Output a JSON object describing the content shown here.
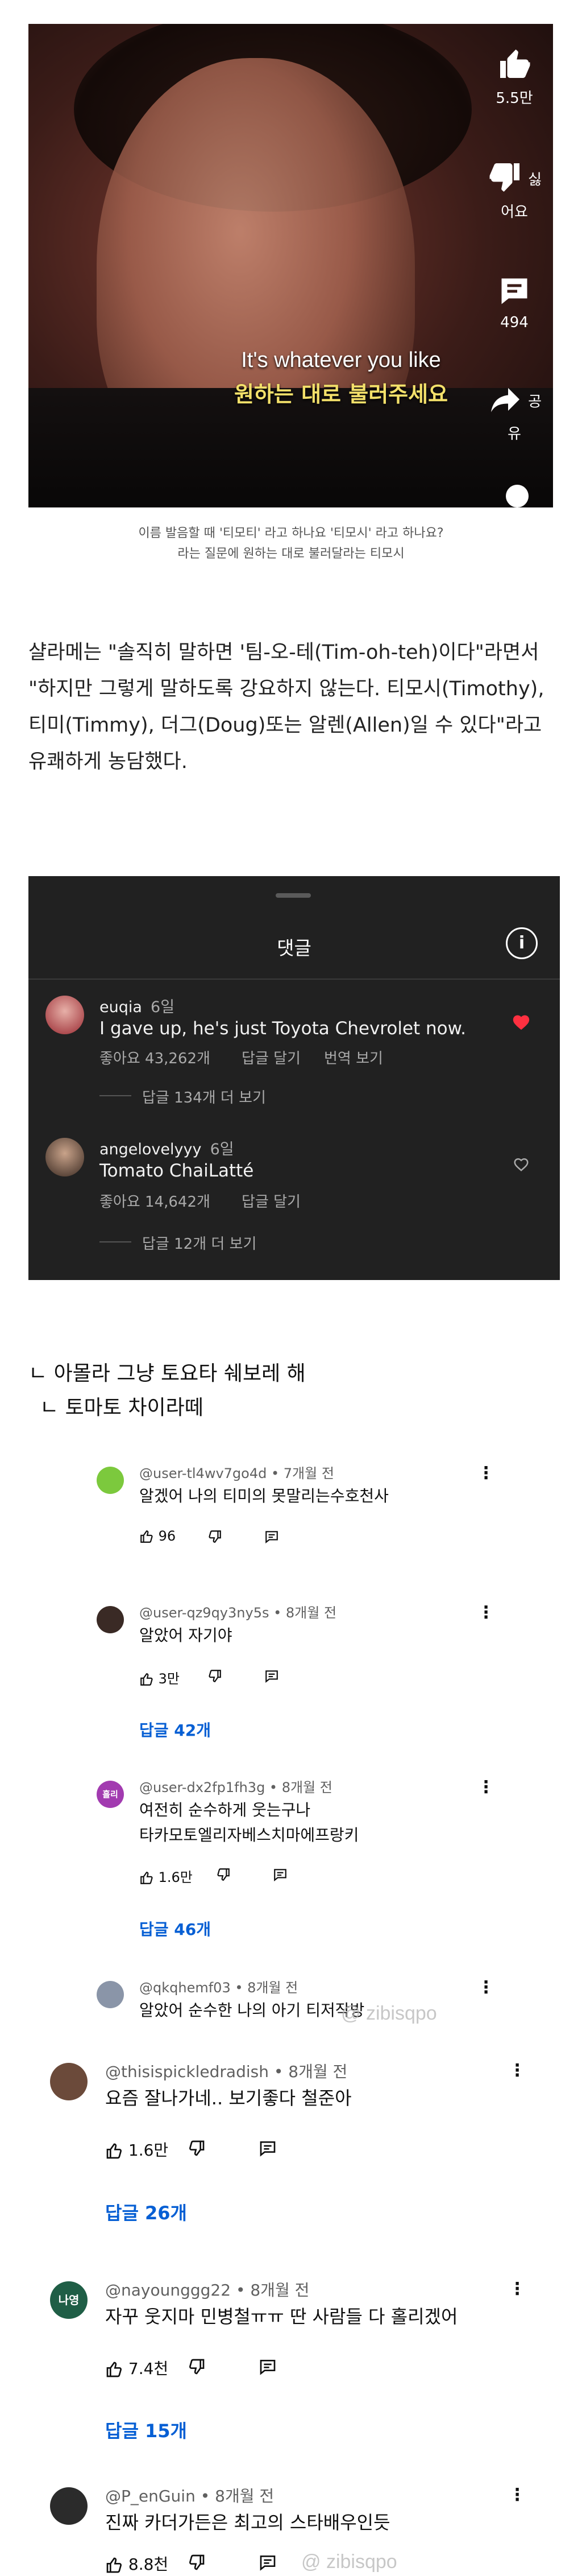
{
  "video": {
    "subtitle_en": "It's whatever you like",
    "subtitle_ko": "원하는 대로 불러주세요",
    "like_count": "5.5만",
    "dislike_label": "싫어요",
    "comment_count": "494",
    "share_label": "공유",
    "caption_line1": "이름 발음할 때 '티모티' 라고 하나요 '티모시' 라고 하나요?",
    "caption_line2": "라는 질문에 원하는 대로 불러달라는 티모시"
  },
  "article": {
    "paragraph": "샬라메는 \"솔직히 말하면 '팀-오-테(Tim-oh-teh)이다\"라면서 \"하지만 그렇게 말하도록 강요하지 않는다. 티모시(Timothy), 티미(Timmy), 더그(Doug)또는 알렌(Allen)일 수 있다\"라고 유쾌하게 농담했다."
  },
  "dark_panel": {
    "title": "댓글",
    "comments": [
      {
        "user": "euqia",
        "age": "6일",
        "text": "I gave up, he's just Toyota Chevrolet now.",
        "likes": "좋아요 43,262개",
        "reply": "답글 달기",
        "translate": "번역 보기",
        "view_replies": "답글 134개 더 보기"
      },
      {
        "user": "angelovelyyy",
        "age": "6일",
        "text": "Tomato ChaiLatté",
        "likes": "좋아요 14,642개",
        "reply": "답글 달기",
        "view_replies": "답글 12개 더 보기"
      }
    ]
  },
  "threads": {
    "line1": "ㄴ 아몰라 그냥 토요타 쉐보레 해",
    "line2": "ㄴ 토마토 차이라떼"
  },
  "comments_small": [
    {
      "user": "@user-tl4wv7go4d • 7개월 전",
      "text": "알겠어 나의 티미의 못말리는수호천사",
      "likes": "96",
      "avatar_color": "#7cc93d",
      "avatar_text": ""
    },
    {
      "user": "@user-qz9qy3ny5s • 8개월 전",
      "text": "알았어 자기야",
      "likes": "3만",
      "replies": "답글 42개",
      "avatar_color": "#3a2a25",
      "avatar_text": ""
    },
    {
      "user": "@user-dx2fp1fh3g • 8개월 전",
      "text": "여전히 순수하게 웃는구나",
      "text2": "타카모토엘리자베스치마에프랑키",
      "likes": "1.6만",
      "replies": "답글 46개",
      "avatar_color": "#a23bb0",
      "avatar_text": "흘리"
    },
    {
      "user": "@qkqhemf03 • 8개월 전",
      "text": "알았어 순수한 나의 아기 티저작방",
      "avatar_color": "#8a95a8",
      "avatar_text": ""
    }
  ],
  "comments_large": [
    {
      "user": "@thisispickledradish • 8개월 전",
      "text": "요즘 잘나가네.. 보기좋다 철준아",
      "likes": "1.6만",
      "replies": "답글 26개",
      "avatar_color": "#6b4a3a",
      "avatar_text": ""
    },
    {
      "user": "@nayounggg22 • 8개월 전",
      "text": "자꾸 웃지마 민병철ㅠㅠ 딴 사람들 다 홀리겠어",
      "likes": "7.4천",
      "replies": "답글 15개",
      "avatar_color": "#1f5e46",
      "avatar_text": "나영"
    },
    {
      "user": "@P_enGuin • 8개월 전",
      "text": "진짜 카더가든은 최고의 스타배우인듯",
      "likes": "8.8천",
      "avatar_color": "#2b2b2b",
      "avatar_text": ""
    }
  ],
  "watermark": "@ zibisqpo",
  "colors": {
    "panel_bg": "#212121",
    "reply_blue": "#065fd4",
    "heart_red": "#ff3040"
  }
}
